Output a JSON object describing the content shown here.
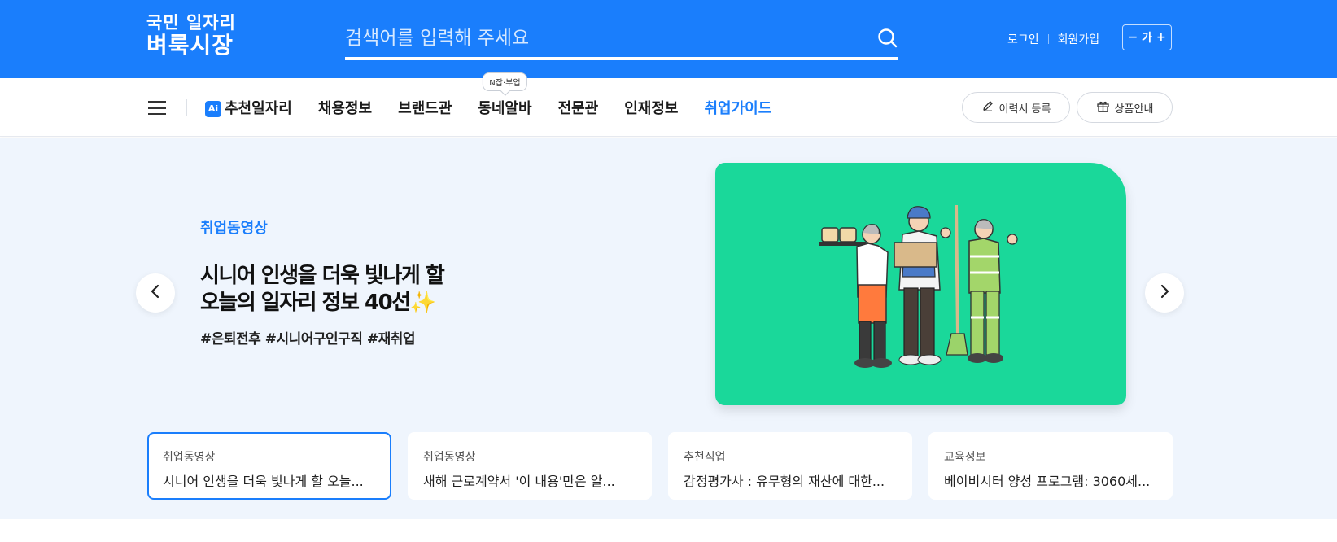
{
  "header": {
    "logo_line1": "국민 일자리",
    "logo_line2": "벼룩시장",
    "search_placeholder": "검색어를 입력해 주세요",
    "login": "로그인",
    "signup": "회원가입",
    "font_minus": "−",
    "font_label": "가",
    "font_plus": "+",
    "brand_color": "#1a7efc"
  },
  "nav": {
    "ai_badge": "Ai",
    "items": [
      "추천일자리",
      "채용정보",
      "브랜드관",
      "동네알바",
      "전문관",
      "인재정보",
      "취업가이드"
    ],
    "tooltip": "N잡·부업",
    "resume_button": "이력서 등록",
    "product_button": "상품안내"
  },
  "hero": {
    "category": "취업동영상",
    "title_line1": "시니어 인생을 더욱 빛나게 할",
    "title_line2": "오늘의 일자리 정보 40선✨",
    "tags": "#은퇴전후 #시니어구인구직 #재취업",
    "image_bg": "#1ad89a"
  },
  "cards": [
    {
      "category": "취업동영상",
      "title": "시니어 인생을 더욱 빛나게 할 오늘..."
    },
    {
      "category": "취업동영상",
      "title": "새해 근로계약서 '이 내용'만은 알..."
    },
    {
      "category": "추천직업",
      "title": "감정평가사 : 유무형의 재산에 대한..."
    },
    {
      "category": "교육정보",
      "title": "베이비시터 양성 프로그램: 3060세..."
    }
  ]
}
